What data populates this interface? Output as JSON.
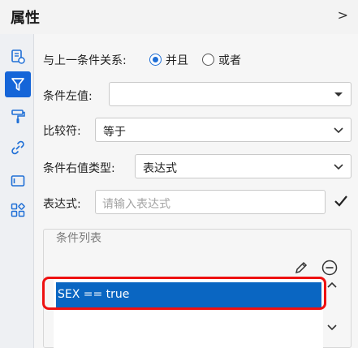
{
  "header": {
    "title": "属性",
    "collapse_glyph": ">"
  },
  "rail": {
    "icons": [
      "form-icon",
      "filter-icon",
      "paint-roller-icon",
      "link-icon",
      "panel-icon",
      "grid-icon"
    ],
    "active": "filter-icon",
    "accent": "#1565d8"
  },
  "form": {
    "relation_label": "与上一条件关系:",
    "relation_options": [
      {
        "label": "并且",
        "selected": true
      },
      {
        "label": "或者",
        "selected": false
      }
    ],
    "left_value_label": "条件左值:",
    "left_value": "",
    "operator_label": "比较符:",
    "operator_value": "等于",
    "right_type_label": "条件右值类型:",
    "right_type_value": "表达式",
    "expression_label": "表达式:",
    "expression_value": "",
    "expression_placeholder": "请输入表达式"
  },
  "condition_list": {
    "title": "条件列表",
    "items": [
      "SEX == true"
    ],
    "selected_index": 0,
    "selection_color": "#0a66c2",
    "highlight_color": "#ee1111"
  }
}
